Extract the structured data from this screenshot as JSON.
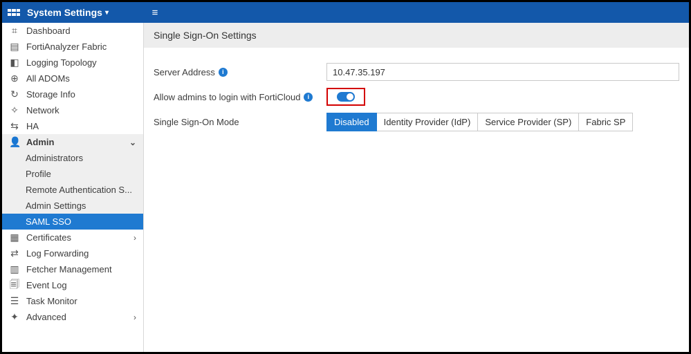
{
  "header": {
    "title": "System Settings",
    "caret": "▾",
    "menu_glyph": "≡"
  },
  "sidebar": {
    "items": [
      {
        "icon": "⌗",
        "label": "Dashboard",
        "caret": ""
      },
      {
        "icon": "▤",
        "label": "FortiAnalyzer Fabric",
        "caret": ""
      },
      {
        "icon": "◧",
        "label": "Logging Topology",
        "caret": ""
      },
      {
        "icon": "⊕",
        "label": "All ADOMs",
        "caret": ""
      },
      {
        "icon": "↻",
        "label": "Storage Info",
        "caret": ""
      },
      {
        "icon": "✧",
        "label": "Network",
        "caret": ""
      },
      {
        "icon": "⇆",
        "label": "HA",
        "caret": ""
      },
      {
        "icon": "👤",
        "label": "Admin",
        "caret": "⌄",
        "expanded": true,
        "children": [
          {
            "label": "Administrators"
          },
          {
            "label": "Profile"
          },
          {
            "label": "Remote Authentication S..."
          },
          {
            "label": "Admin Settings"
          },
          {
            "label": "SAML SSO",
            "selected": true
          }
        ]
      },
      {
        "icon": "▦",
        "label": "Certificates",
        "caret": "›"
      },
      {
        "icon": "⇄",
        "label": "Log Forwarding",
        "caret": ""
      },
      {
        "icon": "▥",
        "label": "Fetcher Management",
        "caret": ""
      },
      {
        "icon": "🗐",
        "label": "Event Log",
        "caret": ""
      },
      {
        "icon": "☰",
        "label": "Task Monitor",
        "caret": ""
      },
      {
        "icon": "✦",
        "label": "Advanced",
        "caret": "›"
      }
    ]
  },
  "main": {
    "panel_title": "Single Sign-On Settings",
    "rows": {
      "server_address": {
        "label": "Server Address",
        "value": "10.47.35.197"
      },
      "forticloud": {
        "label": "Allow admins to login with FortiCloud"
      },
      "sso_mode": {
        "label": "Single Sign-On Mode",
        "options": [
          {
            "label": "Disabled",
            "active": true
          },
          {
            "label": "Identity Provider (IdP)"
          },
          {
            "label": "Service Provider (SP)"
          },
          {
            "label": "Fabric SP"
          }
        ]
      }
    }
  },
  "info_glyph": "i"
}
